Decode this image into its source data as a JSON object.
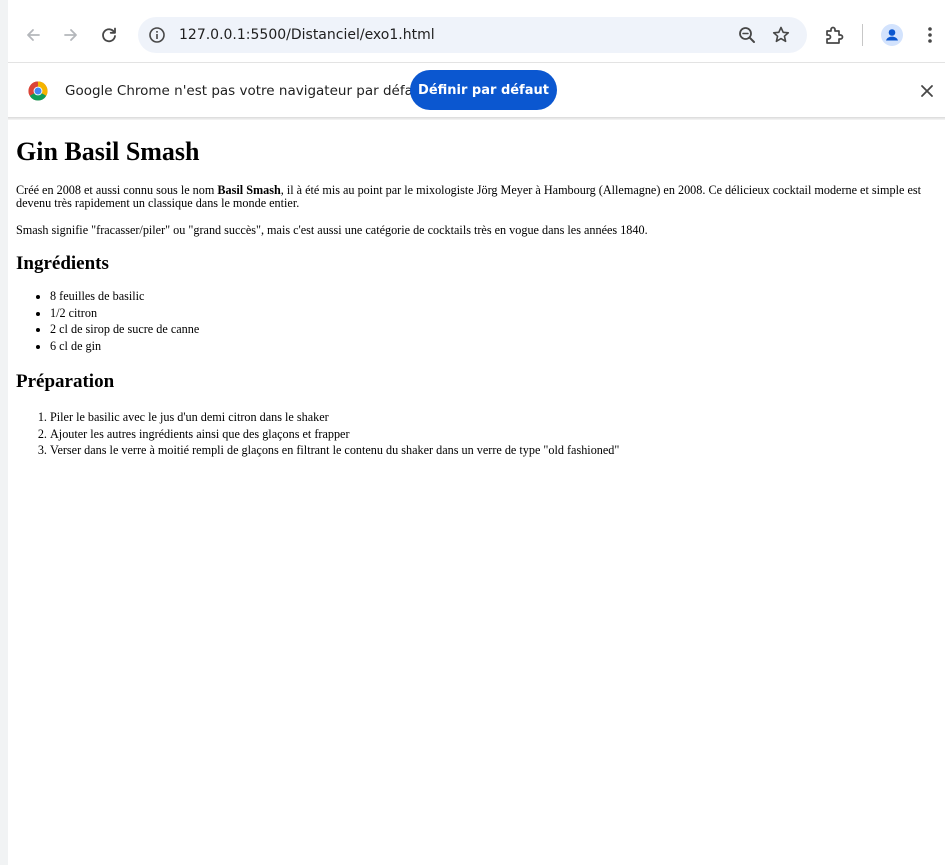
{
  "browser": {
    "url": "127.0.0.1:5500/Distanciel/exo1.html",
    "icons": {
      "back": "arrow-left-icon",
      "forward": "arrow-right-icon",
      "reload": "reload-icon",
      "site_info": "info-icon",
      "zoom": "zoom-icon",
      "bookmark": "star-icon",
      "extensions": "puzzle-icon",
      "profile": "avatar-icon",
      "menu": "kebab-menu-icon"
    },
    "accent_color": "#0b57d0"
  },
  "infobar": {
    "message": "Google Chrome n'est pas votre navigateur par défaut",
    "default_button_label": "Définir par défaut",
    "icons": {
      "chrome": "chrome-logo-icon",
      "close": "close-icon"
    }
  },
  "content": {
    "title": "Gin Basil Smash",
    "intro": {
      "before": "Créé en 2008 et aussi connu sous le nom ",
      "bold": "Basil Smash",
      "after": ", il à été mis au point par le mixologiste Jörg Meyer à Hambourg (Allemagne) en 2008. Ce délicieux cocktail moderne et simple est devenu très rapidement un classique dans le monde entier."
    },
    "smash_paragraph": "Smash signifie \"fracasser/piler\" ou \"grand succès\", mais c'est aussi une catégorie de cocktails très en vogue dans les années 1840.",
    "ingredients_heading": "Ingrédients",
    "ingredients": [
      "8 feuilles de basilic",
      "1/2 citron",
      "2 cl de sirop de sucre de canne",
      "6 cl de gin"
    ],
    "preparation_heading": "Préparation",
    "steps": [
      "Piler le basilic avec le jus d'un demi citron dans le shaker",
      "Ajouter les autres ingrédients ainsi que des glaçons et frapper",
      "Verser dans le verre à moitié rempli de glaçons en filtrant le contenu du shaker dans un verre de type \"old fashioned\""
    ]
  }
}
